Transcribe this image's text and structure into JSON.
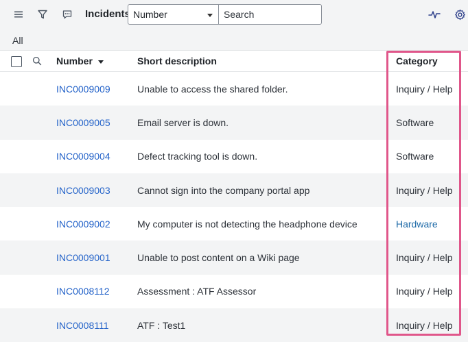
{
  "toolbar": {
    "title": "Incidents",
    "field_select": "Number",
    "search_placeholder": "Search"
  },
  "breadcrumb": "All",
  "columns": {
    "number": "Number",
    "short_description": "Short description",
    "category": "Category"
  },
  "rows": [
    {
      "number": "INC0009009",
      "short_description": "Unable to access the shared folder.",
      "category": "Inquiry / Help"
    },
    {
      "number": "INC0009005",
      "short_description": "Email server is down.",
      "category": "Software"
    },
    {
      "number": "INC0009004",
      "short_description": "Defect tracking tool is down.",
      "category": "Software"
    },
    {
      "number": "INC0009003",
      "short_description": "Cannot sign into the company portal app",
      "category": "Inquiry / Help"
    },
    {
      "number": "INC0009002",
      "short_description": "My computer is not detecting the headphone device",
      "category": "Hardware"
    },
    {
      "number": "INC0009001",
      "short_description": "Unable to post content on a Wiki page",
      "category": "Inquiry / Help"
    },
    {
      "number": "INC0008112",
      "short_description": "Assessment : ATF Assessor",
      "category": "Inquiry / Help"
    },
    {
      "number": "INC0008111",
      "short_description": "ATF : Test1",
      "category": "Inquiry / Help"
    }
  ],
  "colors": {
    "link": "#2463c9",
    "highlight": "#e0568a",
    "alt_row": "#f3f4f5"
  }
}
